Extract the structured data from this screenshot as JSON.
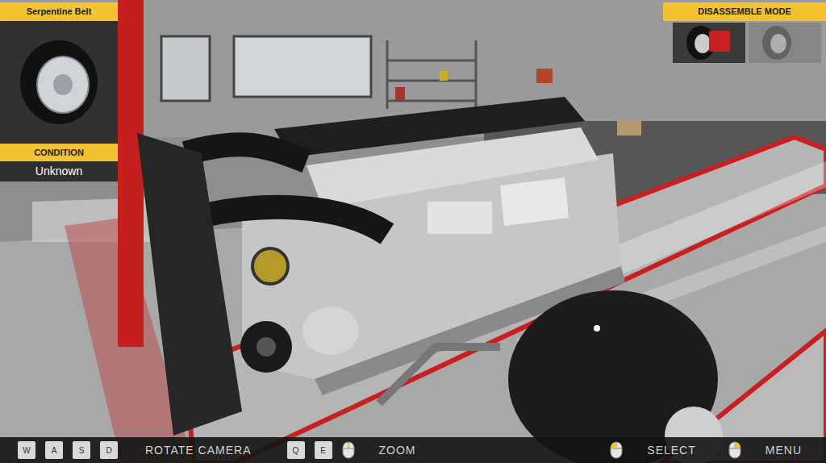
{
  "part_panel": {
    "title": "Serpentine Belt",
    "condition_label": "CONDITION",
    "condition": "Unknown"
  },
  "mode_panel": {
    "title": "DISASSEMBLE MODE",
    "modes": [
      {
        "selected": true
      },
      {
        "selected": false
      }
    ]
  },
  "controls": [
    {
      "keys": [
        "W",
        "A",
        "S",
        "D"
      ],
      "mouse": "none",
      "label": "ROTATE CAMERA"
    },
    {
      "keys": [
        "Q",
        "E"
      ],
      "mouse": "wheel",
      "label": "ZOOM"
    },
    {
      "keys": [],
      "mouse": "left",
      "label": "SELECT"
    },
    {
      "keys": [],
      "mouse": "right",
      "label": "MENU"
    }
  ]
}
